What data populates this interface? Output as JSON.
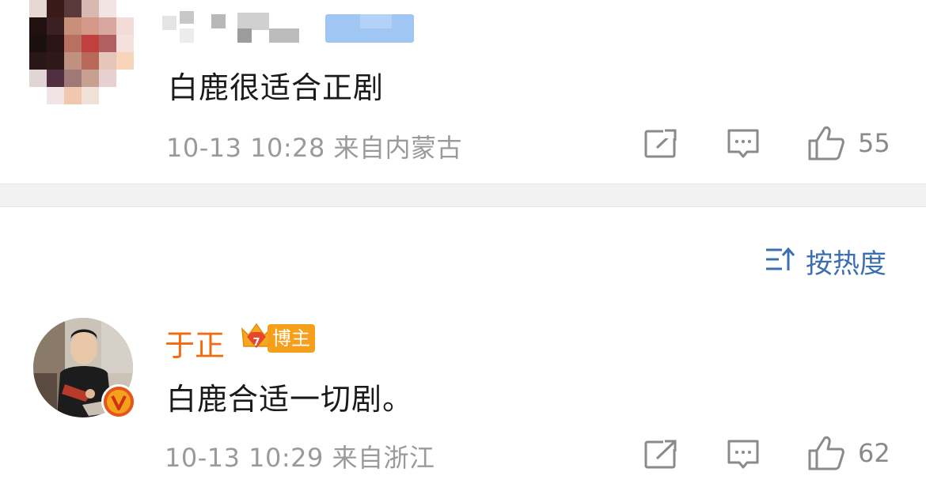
{
  "comments": [
    {
      "username": "",
      "text": "白鹿很适合正剧",
      "timestamp": "10-13 10:28",
      "location": "来自内蒙古",
      "likes": "55",
      "avatar_pixelated": true
    },
    {
      "username": "于正",
      "badge_label": "博主",
      "badge_level": "7",
      "verified_icon": "v-verified-icon",
      "text": "白鹿合适一切剧。",
      "timestamp": "10-13 10:29",
      "location": "来自浙江",
      "likes": "62"
    }
  ],
  "sort": {
    "label": "按热度",
    "icon": "sort-icon"
  },
  "icons": {
    "share": "share-icon",
    "comment": "comment-icon",
    "like": "thumbs-up-icon"
  },
  "colors": {
    "author_name": "#f26b0f",
    "sort_label": "#3b6fb0",
    "meta": "#9a9a9a",
    "divider": "#f2f2f2"
  }
}
